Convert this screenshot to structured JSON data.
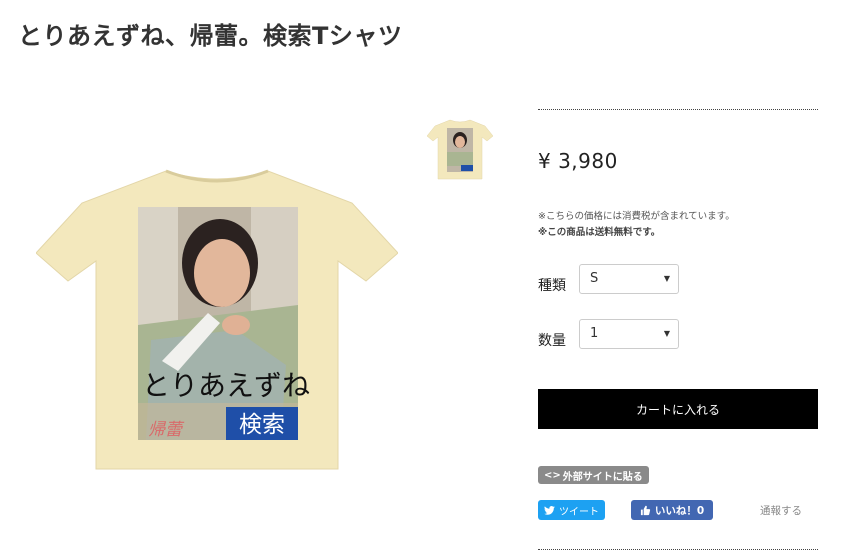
{
  "product": {
    "title": "とりあえずね、帰蕾。検索Tシャツ",
    "price": "¥ 3,980",
    "tax_note": "※こちらの価格には消費税が含まれています。",
    "shipping_note": "※この商品は送料無料です。",
    "shirt_color": "#f3e8bd"
  },
  "image": {
    "text_main": "とりあえずね",
    "text_search": "検索",
    "text_signature": "帰蕾"
  },
  "options": {
    "type_label": "種類",
    "type_value": "S",
    "quantity_label": "数量",
    "quantity_value": "1"
  },
  "actions": {
    "cart_label": "カートに入れる",
    "embed_label": "外部サイトに貼る",
    "tweet_label": "ツイート",
    "like_label": "いいね！0",
    "report_label": "通報する"
  }
}
